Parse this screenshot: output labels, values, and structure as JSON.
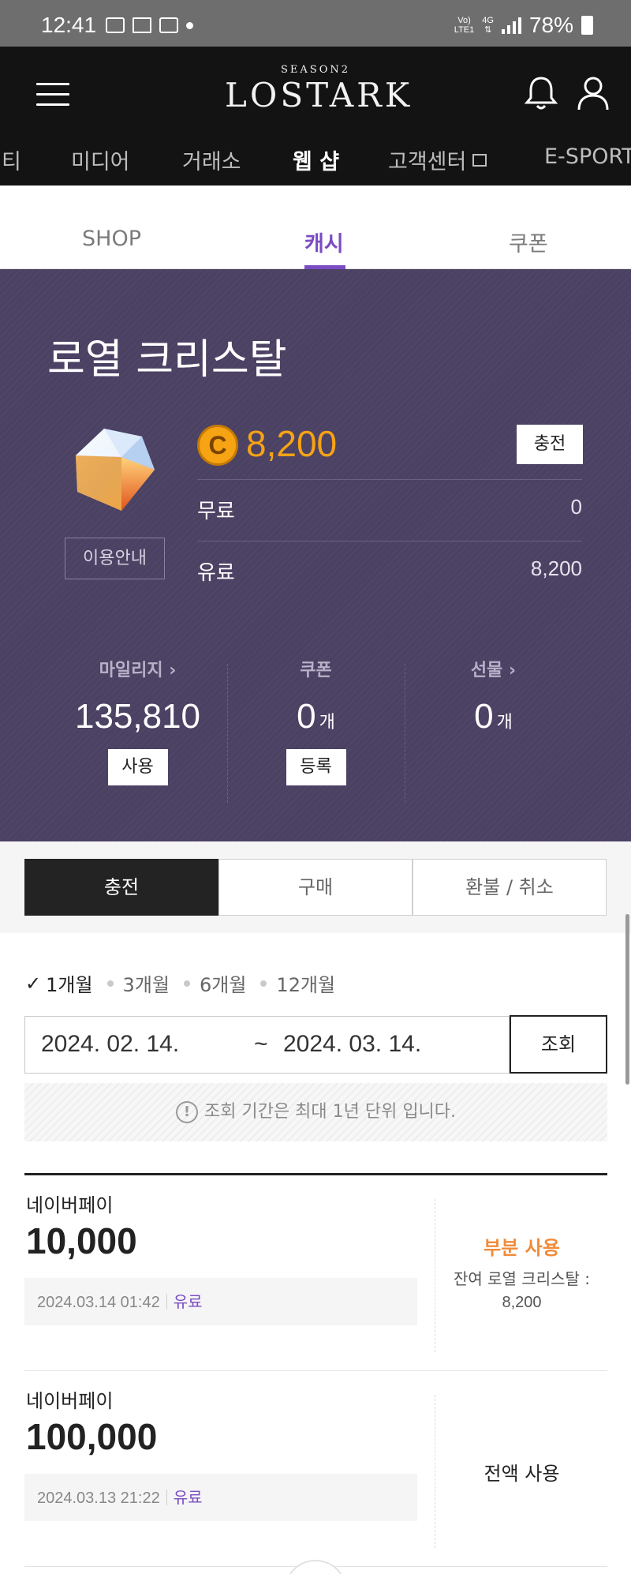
{
  "status_bar": {
    "time": "12:41",
    "volte_top": "Vo)",
    "volte_bottom": "LTE1",
    "network": "4G",
    "battery": "78%"
  },
  "header": {
    "logo_season": "SEASON2",
    "logo_name": "LOSTARK",
    "nav": [
      {
        "label": "티"
      },
      {
        "label": "미디어"
      },
      {
        "label": "거래소"
      },
      {
        "label": "웹 샵",
        "active": true
      },
      {
        "label": "고객센터"
      },
      {
        "label": "E-SPORT"
      }
    ]
  },
  "subtabs": [
    {
      "label": "SHOP"
    },
    {
      "label": "캐시",
      "active": true
    },
    {
      "label": "쿠폰"
    }
  ],
  "wallet": {
    "title": "로열 크리스탈",
    "guide_label": "이용안내",
    "coin_symbol": "C",
    "balance": "8,200",
    "charge_label": "충전",
    "rows": [
      {
        "label": "무료",
        "value": "0"
      },
      {
        "label": "유료",
        "value": "8,200"
      }
    ],
    "stats": [
      {
        "label": "마일리지 ›",
        "value": "135,810",
        "unit": "",
        "button": "사용"
      },
      {
        "label": "쿠폰",
        "value": "0",
        "unit": "개",
        "button": "등록"
      },
      {
        "label": "선물 ›",
        "value": "0",
        "unit": "개",
        "button": ""
      }
    ]
  },
  "history_tabs": [
    {
      "label": "충전",
      "active": true
    },
    {
      "label": "구매"
    },
    {
      "label": "환불 / 취소"
    }
  ],
  "periods": [
    {
      "label": "1개월",
      "active": true
    },
    {
      "label": "3개월"
    },
    {
      "label": "6개월"
    },
    {
      "label": "12개월"
    }
  ],
  "date_range": {
    "start": "2024. 02. 14.",
    "separator": "~",
    "end": "2024. 03. 14.",
    "search_label": "조회"
  },
  "notice": {
    "icon": "!",
    "text": "조회 기간은 최대 1년 단위 입니다."
  },
  "records": [
    {
      "method": "네이버페이",
      "amount": "10,000",
      "datetime": "2024.03.14 01:42",
      "type": "유료",
      "status": "부분 사용",
      "remain_label": "잔여 로열 크리스탈 :",
      "remain_value": "8,200"
    },
    {
      "method": "네이버페이",
      "amount": "100,000",
      "datetime": "2024.03.13 21:22",
      "type": "유료",
      "status": "전액 사용"
    }
  ],
  "colors": {
    "accent_purple": "#7b4cc4",
    "panel_bg": "#4b4163",
    "coin_gold": "#f6a314",
    "partial_orange": "#f08b3a"
  }
}
